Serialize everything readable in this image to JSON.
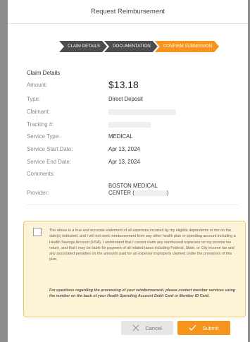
{
  "header": {
    "title": "Request Reimbursement"
  },
  "steps": [
    {
      "label": "CLAIM DETAILS",
      "active": false
    },
    {
      "label": "DOCUMENTATION",
      "active": false
    },
    {
      "label": "CONFIRM SUBMISSION",
      "active": true
    }
  ],
  "details": {
    "title": "Claim Details",
    "amount_label": "Amount:",
    "amount_value": "$13.18",
    "type_label": "Type:",
    "type_value": "Direct Deposit",
    "claimant_label": "Claimant:",
    "tracking_label": "Tracking #:",
    "service_type_label": "Service Type:",
    "service_type_value": "MEDICAL",
    "start_label": "Service Start Date:",
    "start_value": "Apr 13, 2024",
    "end_label": "Service End Date:",
    "end_value": "Apr 13, 2024",
    "comments_label": "Comments:",
    "provider_label": "Provider:",
    "provider_line1": "BOSTON MEDICAL",
    "provider_line2_prefix": "CENTER (",
    "provider_line2_suffix": ")"
  },
  "attestation": {
    "text": "The above is a true and accurate statement of all expenses incurred by my eligible dependents or me on the date(s) indicated, and I will not seek reimbursement from any other health plan or spending account including a Health Savings Account (HSA). I understand that I cannot claim any reimbursed expenses on my income tax return, and that I may be liable for payment of all related taxes including Federal, State, or City income tax and any associated penalties on the amounts paid for an expense improperly claimed under the provisions of this plan.",
    "note": "For questions regarding the processing of your reimbursement, please contact member services using the number on the back of your Health Spending Account Debit Card or Member ID Card."
  },
  "buttons": {
    "cancel": "Cancel",
    "submit": "Submit"
  },
  "colors": {
    "accent": "#f7941d",
    "step_inactive": "#4d4d4d",
    "attest_bg": "#fdf3d6"
  }
}
